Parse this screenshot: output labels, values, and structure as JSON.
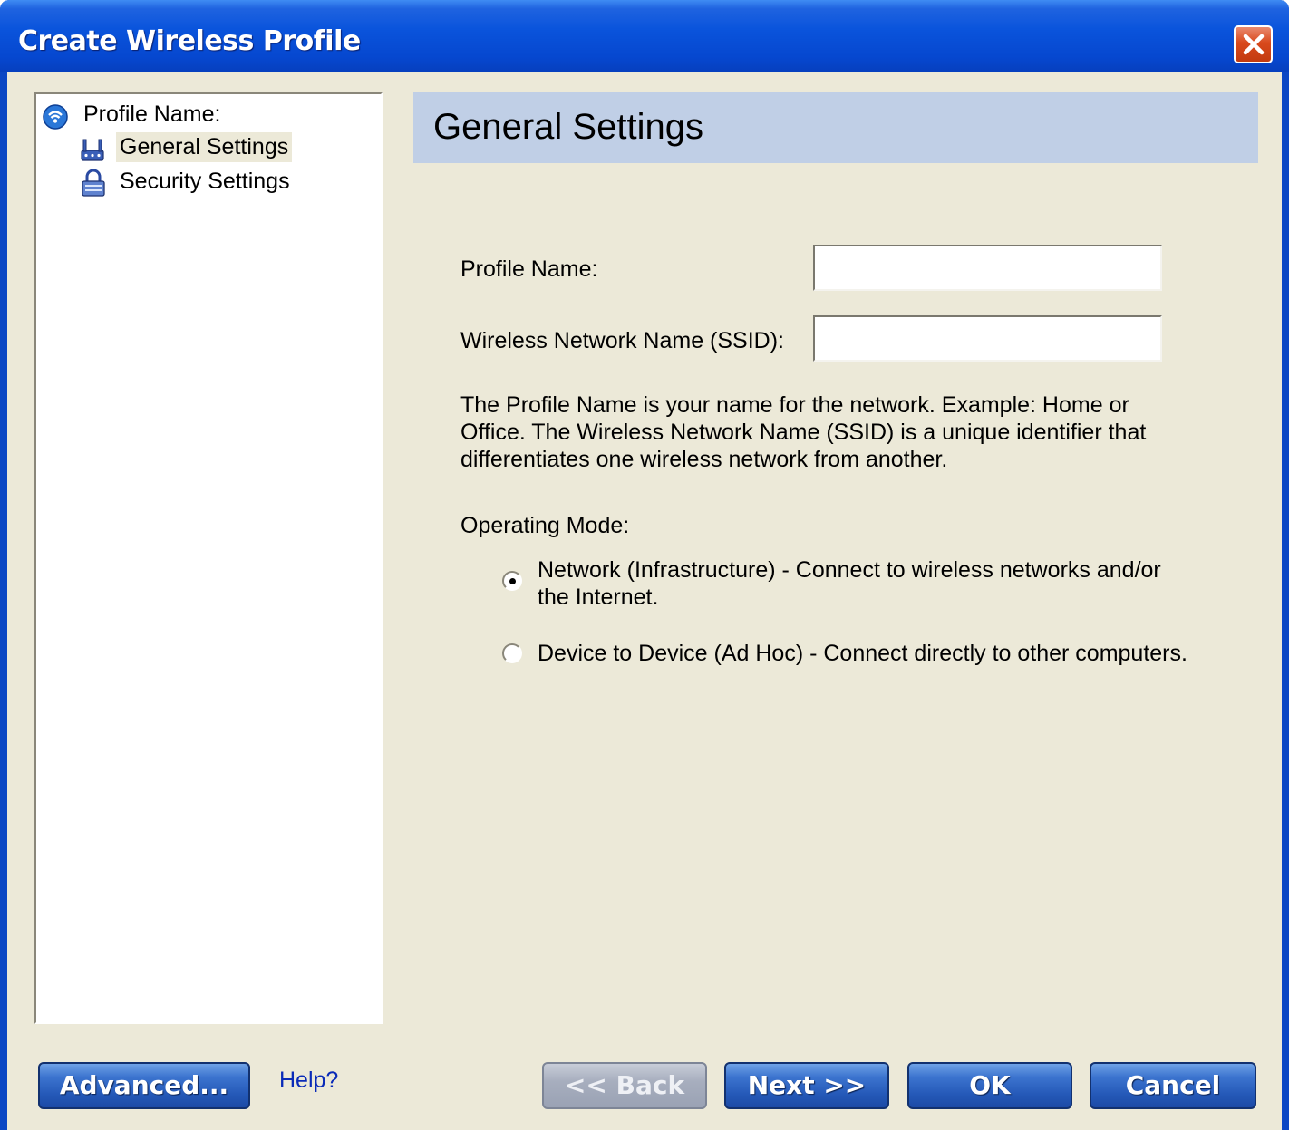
{
  "window": {
    "title": "Create Wireless Profile"
  },
  "tree": {
    "root_label": "Profile Name:",
    "items": [
      {
        "label": "General Settings",
        "icon": "network-adapter-icon",
        "selected": true
      },
      {
        "label": "Security Settings",
        "icon": "lock-icon",
        "selected": false
      }
    ]
  },
  "header": {
    "title": "General Settings"
  },
  "form": {
    "profile_name": {
      "label": "Profile Name:",
      "value": ""
    },
    "ssid": {
      "label": "Wireless Network Name (SSID):",
      "value": ""
    },
    "description": "The Profile Name is your name for the network. Example: Home or Office. The Wireless Network Name (SSID) is a unique identifier that differentiates one wireless network from another.",
    "operating_mode": {
      "label": "Operating Mode:",
      "options": [
        {
          "label": "Network (Infrastructure) - Connect to wireless networks and/or the Internet.",
          "checked": true
        },
        {
          "label": "Device to Device (Ad Hoc) - Connect directly to other computers.",
          "checked": false
        }
      ]
    }
  },
  "buttons": {
    "advanced": "Advanced...",
    "help": "Help?",
    "back": "<< Back",
    "next": "Next >>",
    "ok": "OK",
    "cancel": "Cancel"
  },
  "colors": {
    "titlebar": "#0a54dc",
    "dialog_bg": "#ece9d8",
    "header_band": "#c0cfe6",
    "button_blue": "#2559b8"
  }
}
